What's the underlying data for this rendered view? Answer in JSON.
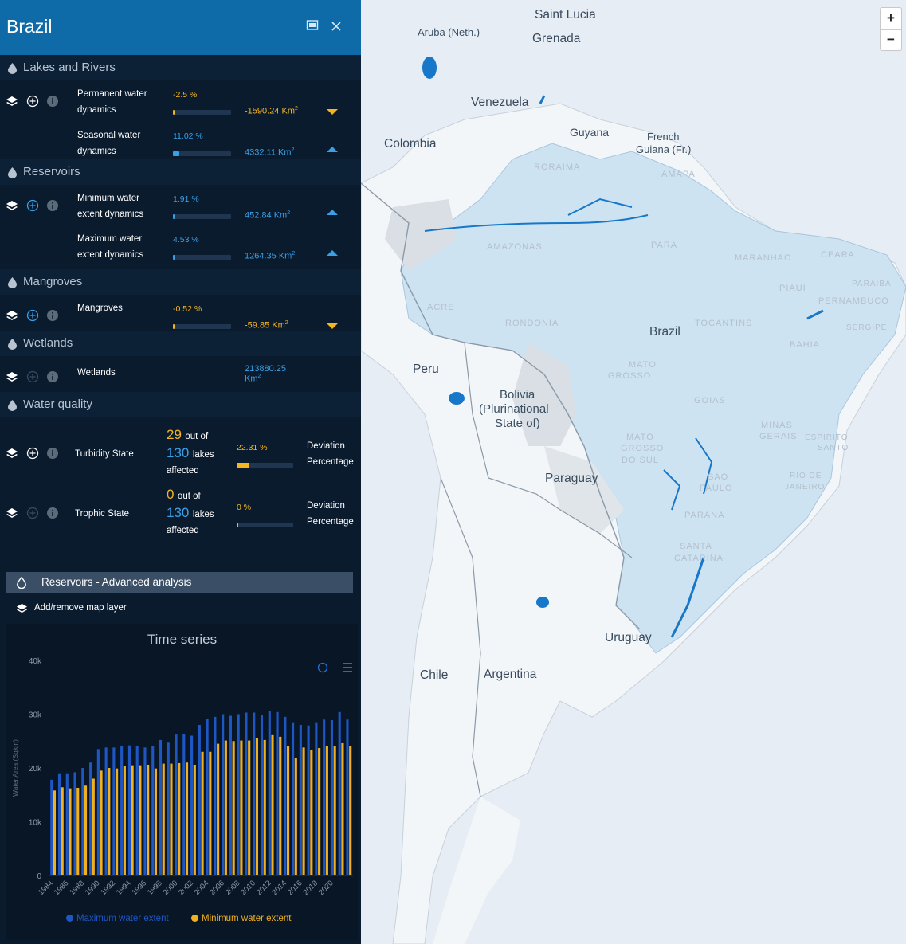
{
  "panel": {
    "title": "Brazil",
    "sections": {
      "lakes": "Lakes and Rivers",
      "reservoirs": "Reservoirs",
      "mangroves": "Mangroves",
      "wetlands": "Wetlands",
      "water_quality": "Water quality"
    },
    "lakes_rows": [
      {
        "label": "Permanent water dynamics",
        "percent": "-2.5 %",
        "area": "-1590.24 Km",
        "trend": "down",
        "bar": 0.02
      },
      {
        "label": "Seasonal water dynamics",
        "percent": "11.02 %",
        "area": "4332.11 Km",
        "trend": "up",
        "bar": 0.11
      }
    ],
    "reservoir_rows": [
      {
        "label": "Minimum water extent dynamics",
        "percent": "1.91 %",
        "area": "452.84 Km",
        "trend": "up",
        "bar": 0.02
      },
      {
        "label": "Maximum water extent dynamics",
        "percent": "4.53 %",
        "area": "1264.35 Km",
        "trend": "up",
        "bar": 0.045
      }
    ],
    "mangrove_row": {
      "label": "Mangroves",
      "percent": "-0.52 %",
      "area": "-59.85 Km",
      "trend": "down",
      "bar": 0.01
    },
    "wetland_row": {
      "label": "Wetlands",
      "area_line1": "213880.25",
      "area_line2": "Km"
    },
    "quality_rows": [
      {
        "label": "Turbidity State",
        "affected": "29",
        "out_of": "out of",
        "total": "130",
        "lakes": "lakes",
        "affected_word": "affected",
        "percent": "22.31 %",
        "bar": 0.2231,
        "dev1": "Deviation",
        "dev2": "Percentage"
      },
      {
        "label": "Trophic State",
        "affected": "0",
        "out_of": "out of",
        "total": "130",
        "lakes": "lakes",
        "affected_word": "affected",
        "percent": "0 %",
        "bar": 0.0,
        "dev1": "Deviation",
        "dev2": "Percentage"
      }
    ],
    "superscript": "2",
    "advanced": "Reservoirs - Advanced analysis",
    "add_remove": "Add/remove map layer"
  },
  "colors": {
    "panel_bg": "#0b1b2e",
    "header_bg": "#0f6aa8",
    "accent_yellow": "#f4b521",
    "accent_blue": "#3aa0e6",
    "max_series": "#1e56c4",
    "min_series": "#f0b020"
  },
  "chart_data": {
    "type": "bar",
    "title": "Time series",
    "ylabel": "Water Area (Sqkm)",
    "ylim": [
      0,
      40000
    ],
    "yticks": [
      "0",
      "10k",
      "20k",
      "30k",
      "40k"
    ],
    "xtick_labels": [
      "1984",
      "1986",
      "1988",
      "1990",
      "1992",
      "1994",
      "1996",
      "1998",
      "2000",
      "2002",
      "2004",
      "2006",
      "2008",
      "2010",
      "2012",
      "2014",
      "2016",
      "2018",
      "2020"
    ],
    "categories": [
      1984,
      1985,
      1986,
      1987,
      1988,
      1989,
      1990,
      1991,
      1992,
      1993,
      1994,
      1995,
      1996,
      1997,
      1998,
      1999,
      2000,
      2001,
      2002,
      2003,
      2004,
      2005,
      2006,
      2007,
      2008,
      2009,
      2010,
      2011,
      2012,
      2013,
      2014,
      2015,
      2016,
      2017,
      2018,
      2019,
      2020,
      2021
    ],
    "series": [
      {
        "name": "Maximum water extent",
        "values": [
          17800,
          19000,
          19000,
          19200,
          20000,
          21000,
          23500,
          23800,
          23800,
          24000,
          24200,
          24000,
          23800,
          24000,
          25200,
          24700,
          26200,
          26300,
          26000,
          28000,
          29100,
          29500,
          30000,
          29700,
          30000,
          30300,
          30300,
          29800,
          30600,
          30400,
          29500,
          28500,
          28000,
          27900,
          28500,
          29000,
          28900,
          30400,
          29000
        ]
      },
      {
        "name": "Minimum water extent",
        "values": [
          15800,
          16400,
          16200,
          16300,
          16700,
          18000,
          19500,
          20000,
          19900,
          20300,
          20500,
          20500,
          20600,
          19900,
          20800,
          20800,
          20900,
          21000,
          20600,
          23000,
          23000,
          24500,
          25100,
          25000,
          25100,
          25100,
          25600,
          25200,
          26100,
          25800,
          24100,
          21900,
          23800,
          23300,
          23700,
          24100,
          24000,
          24600,
          24000
        ]
      }
    ],
    "legend_position": "bottom",
    "grid": false
  },
  "map": {
    "labels": {
      "saint_lucia": "Saint Lucia",
      "aruba": "Aruba (Neth.)",
      "grenada": "Grenada",
      "venezuela": "Venezuela",
      "guyana": "Guyana",
      "french_guiana_1": "French",
      "french_guiana_2": "Guiana (Fr.)",
      "colombia": "Colombia",
      "roraima": "RORAIMA",
      "amapa": "AMAPA",
      "amazonas": "AMAZONAS",
      "para": "PARA",
      "maranhao": "MARANHAO",
      "ceara": "CEARA",
      "piaui": "PIAUI",
      "paraiba": "PARAIBA",
      "pernambuco": "PERNAMBUCO",
      "acre": "ACRE",
      "rondonia": "RONDONIA",
      "brazil": "Brazil",
      "tocantins": "TOCANTINS",
      "sergipe": "SERGIPE",
      "bahia": "BAHIA",
      "peru": "Peru",
      "mato_grosso_1": "MATO",
      "mato_grosso_2": "GROSSO",
      "bolivia_1": "Bolivia",
      "bolivia_2": "(Plurinational",
      "bolivia_3": "State of)",
      "goias": "GOIAS",
      "minas_1": "MINAS",
      "minas_2": "GERAIS",
      "espirito_1": "ESPIRITO",
      "espirito_2": "SANTO",
      "ms_1": "MATO",
      "ms_2": "GROSSO",
      "ms_3": "DO SUL",
      "paraguay": "Paraguay",
      "sao_paulo_1": "SAO",
      "sao_paulo_2": "PAULO",
      "rio_1": "RIO DE",
      "rio_2": "JANEIRO",
      "parana": "PARANA",
      "santa_1": "SANTA",
      "santa_2": "CATARINA",
      "uruguay": "Uruguay",
      "chile": "Chile",
      "argentina": "Argentina"
    },
    "zoom_in": "+",
    "zoom_out": "−"
  }
}
